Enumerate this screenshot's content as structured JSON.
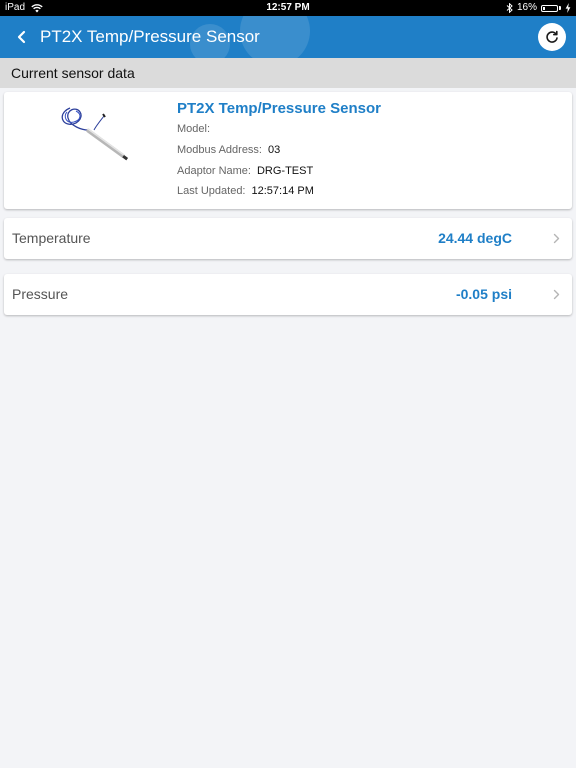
{
  "status_bar": {
    "device": "iPad",
    "time": "12:57 PM",
    "battery": "16%",
    "battery_level": 0.16
  },
  "nav": {
    "title": "PT2X Temp/Pressure Sensor",
    "back_icon": "chevron-left-icon",
    "refresh_icon": "refresh-icon",
    "color": "#1f7fc7"
  },
  "section": {
    "title": "Current sensor data"
  },
  "sensor": {
    "name": "PT2X Temp/Pressure Sensor",
    "model_label": "Model:",
    "model_value": "",
    "modbus_label": "Modbus Address:",
    "modbus_value": "03",
    "adaptor_label": "Adaptor Name:",
    "adaptor_value": "DRG-TEST",
    "updated_label": "Last Updated:",
    "updated_value": "12:57:14 PM"
  },
  "readings": [
    {
      "label": "Temperature",
      "value": "24.44 degC"
    },
    {
      "label": "Pressure",
      "value": "-0.05 psi"
    }
  ]
}
